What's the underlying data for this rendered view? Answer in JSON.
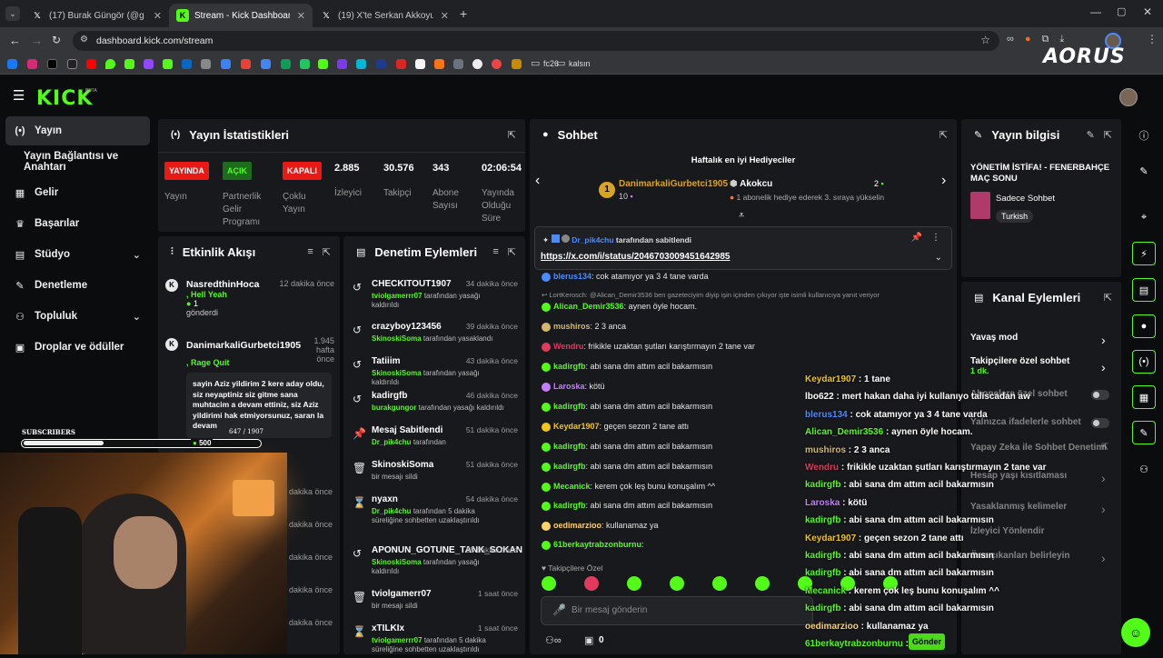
{
  "browser": {
    "tabs": [
      {
        "title": "(17) Burak Güngör (@gungorbu",
        "icon": "X"
      },
      {
        "title": "Stream - Kick Dashboard",
        "icon": "K"
      },
      {
        "title": "(19) X'te Serkan Akkoyun: \"Fen",
        "icon": "X"
      }
    ],
    "url": "dashboard.kick.com/stream",
    "bookmarks": [
      "fc26",
      "kalsın"
    ],
    "brand_overlay": "AORUS"
  },
  "app": {
    "logo": "KICK",
    "logo_sup": "BETA",
    "nav": [
      {
        "label": "Yayın",
        "icon": "(•)"
      },
      {
        "label": "Yayın Bağlantısı ve Anahtarı",
        "icon": ""
      },
      {
        "label": "Gelir",
        "icon": "▦"
      },
      {
        "label": "Başarılar",
        "icon": "🏆"
      },
      {
        "label": "Stüdyo",
        "icon": "▤"
      },
      {
        "label": "Denetleme",
        "icon": "🔧"
      },
      {
        "label": "Topluluk",
        "icon": "👥"
      },
      {
        "label": "Droplar ve ödüller",
        "icon": "🎁"
      }
    ]
  },
  "stats": {
    "title": "Yayın İstatistikleri",
    "items": [
      {
        "badge": "YAYINDA",
        "label": "Yayın",
        "color": "#e91916"
      },
      {
        "badge": "AÇIK",
        "label": "Partnerlik Gelir Programı",
        "color": "#2aa829"
      },
      {
        "badge": "KAPALI",
        "label": "Çoklu Yayın",
        "color": "#e91916"
      },
      {
        "value": "2.885",
        "label": "İzleyici"
      },
      {
        "value": "30.576",
        "label": "Takipçi"
      },
      {
        "value": "343",
        "label": "Abone Sayısı"
      },
      {
        "value": "02:06:54",
        "label": "Yayında Olduğu Süre"
      }
    ]
  },
  "activity": {
    "title": "Etkinlik Akışı",
    "items": [
      {
        "user": "NasredthinHoca",
        "time": "12 dakika önce",
        "msg": "Hell Yeah",
        "count": "1",
        "sub": "gönderdi"
      },
      {
        "user": "DanimarkaliGurbetci1905",
        "time": "1.945 hafta önce",
        "msg": "Rage Quit",
        "text": "sayin Aziz yildirim 2 kere aday oldu, siz neyaptiniz siz gitme sana muhtacim a devam ettiniz, siz Aziz yildirimi hak etmiyorsunuz, saran la devam"
      }
    ],
    "more_times": [
      "dakika önce",
      "dakika önce",
      "dakika önce",
      "dakika önce",
      "dakika önce",
      "dakika önce"
    ]
  },
  "mod": {
    "title": "Denetim Eylemleri",
    "items": [
      {
        "icon": "↺",
        "name": "CHECKITOUT1907",
        "time": "34 dakika önce",
        "actor": "tviolgamerrr07",
        "desc": "tarafından yasağı kaldırıldı"
      },
      {
        "icon": "↺",
        "name": "crazyboy123456",
        "time": "39 dakika önce",
        "actor": "SkinoskiSoma",
        "desc": "tarafından yasaklandı"
      },
      {
        "icon": "↺",
        "name": "Tatiiim",
        "time": "43 dakika önce",
        "actor": "SkinoskiSoma",
        "desc": "tarafından yasağı kaldırıldı"
      },
      {
        "icon": "↺",
        "name": "kadirgfb",
        "time": "46 dakika önce",
        "actor": "burakgungor",
        "desc": "tarafından yasağı kaldırıldı"
      },
      {
        "icon": "📌",
        "name": "Mesaj Sabitlendi",
        "time": "51 dakika önce",
        "actor": "Dr_pik4chu",
        "desc": "tarafından"
      },
      {
        "icon": "🗑",
        "name": "SkinoskiSoma",
        "time": "51 dakika önce",
        "actor": "",
        "desc": "bir mesajı sildi"
      },
      {
        "icon": "⌛",
        "name": "nyaxn",
        "time": "54 dakika önce",
        "actor": "Dr_pik4chu",
        "desc": "tarafından 5 dakika süreliğine sohbetten uzaklaştırıldı"
      },
      {
        "icon": "↺",
        "name": "APONUN_GOTUNE_TANK_SOKAN",
        "time": "55 dakika önce",
        "actor": "SkinoskiSoma",
        "desc": "tarafından yasağı kaldırıldı"
      },
      {
        "icon": "🗑",
        "name": "tviolgamerr07",
        "time": "1 saat önce",
        "actor": "",
        "desc": "bir mesajı sildi"
      },
      {
        "icon": "⌛",
        "name": "xTILKIx",
        "time": "1 saat önce",
        "actor": "tviolgamerrr07",
        "desc": "tarafından 5 dakika süreliğine sohbetten uzaklaştırıldı"
      }
    ]
  },
  "chat": {
    "title": "Sohbet",
    "top_gifters_title": "Haftalık en iyi Hediyeciler",
    "gifter1": {
      "name": "DanimarkaliGurbetci1905",
      "count": "10",
      "rank": "1"
    },
    "gifter2": {
      "name": "Akokcu",
      "count": "2",
      "note": "1 abonelik hediye ederek 3. sıraya yükselin"
    },
    "pinned_by": "Dr_pik4chu",
    "pinned_suffix": "tarafından sabitlendi",
    "pinned_link": "https://x.com/i/status/2046703009451642985",
    "messages": [
      {
        "user": "blerus134",
        "text": "cok atamıyor ya 3 4 tane varda",
        "color": "#4a8cff"
      },
      {
        "user": "",
        "text": "LortKerosch: @Alican_Demir3536 ben gazeteciyim diyip işin içinden çıkıyor işte isimli kullanıcıya yanıt veriyor",
        "color": "#999",
        "reply": true
      },
      {
        "user": "Alican_Demir3536",
        "text": "aynen öyle hocam.",
        "color": "#53fc18"
      },
      {
        "user": "mushiros",
        "text": "2 3 anca",
        "color": "#d4b86a"
      },
      {
        "user": "Wendru",
        "text": "frikikle uzaktan şutları karıştırmayın 2 tane var",
        "color": "#e23a5c"
      },
      {
        "user": "kadirgfb",
        "text": "abi sana dm attım acil bakarmısın",
        "color": "#53fc18"
      },
      {
        "user": "Laroska",
        "text": "kötü",
        "color": "#c77dff"
      },
      {
        "user": "kadirgfb",
        "text": "abi sana dm attım acil bakarmısın",
        "color": "#53fc18"
      },
      {
        "user": "Keydar1907",
        "text": "geçen sezon 2 tane attı",
        "color": "#f0c419"
      },
      {
        "user": "kadirgfb",
        "text": "abi sana dm attım acil bakarmısın",
        "color": "#53fc18"
      },
      {
        "user": "kadirgfb",
        "text": "abi sana dm attım acil bakarmısın",
        "color": "#53fc18"
      },
      {
        "user": "Mecanick",
        "text": "kerem çok leş bunu konuşalım ^^",
        "color": "#53fc18"
      },
      {
        "user": "kadirgfb",
        "text": "abi sana dm attım acil bakarmısın",
        "color": "#53fc18"
      },
      {
        "user": "oedimarzioo",
        "text": "kullanamaz ya",
        "color": "#ffd166"
      },
      {
        "user": "61berkaytrabzonburnu",
        "text": "",
        "color": "#53fc18"
      }
    ],
    "followers_only": "Takipçilere Özel",
    "input_placeholder": "Bir mesaj gönderin",
    "viewer_count": "0"
  },
  "overlay": {
    "lines": [
      {
        "user": "Keydar1907",
        "text": "1 tane",
        "color": "#f0c419"
      },
      {
        "user": "lbo622",
        "text": "mert hakan daha iyi kullanıyo taliscadan aw",
        "color": "#ffffff"
      },
      {
        "user": "blerus134",
        "text": "cok atamıyor ya 3 4 tane varda",
        "color": "#4a8cff"
      },
      {
        "user": "Alican_Demir3536",
        "text": "aynen öyle hocam.",
        "color": "#53fc18"
      },
      {
        "user": "mushiros",
        "text": "2 3 anca",
        "color": "#d4b86a"
      },
      {
        "user": "Wendru",
        "text": "frikikle uzaktan şutları karıştırmayın 2 tane var",
        "color": "#e23a5c"
      },
      {
        "user": "kadirgfb",
        "text": "abi sana dm attım acil bakarmısın",
        "color": "#53fc18"
      },
      {
        "user": "Laroska",
        "text": "kötü",
        "color": "#c77dff"
      },
      {
        "user": "kadirgfb",
        "text": "abi sana dm attım acil bakarmısın",
        "color": "#53fc18"
      },
      {
        "user": "Keydar1907",
        "text": "geçen sezon 2 tane attı",
        "color": "#f0c419"
      },
      {
        "user": "kadirgfb",
        "text": "abi sana dm attım acil bakarmısın",
        "color": "#53fc18"
      },
      {
        "user": "kadirgfb",
        "text": "abi sana dm attım acil bakarmısın",
        "color": "#53fc18"
      },
      {
        "user": "Mecanick",
        "text": "kerem çok leş bunu konuşalım ^^",
        "color": "#53fc18"
      },
      {
        "user": "kadirgfb",
        "text": "abi sana dm attım acil bakarmısın",
        "color": "#53fc18"
      },
      {
        "user": "oedimarzioo",
        "text": "kullanamaz ya",
        "color": "#ffd166"
      },
      {
        "user": "61berkaytrabzonburnu",
        "text": "",
        "color": "#53fc18"
      }
    ],
    "subscribers_label": "SUBSCRIBERS",
    "subs_count": "647 / 1907",
    "subs_progress": 0.34,
    "goal_value": "500",
    "send_label": "Gönder"
  },
  "info": {
    "title": "Yayın bilgisi",
    "stream_title": "YÖNETİM İSTİFA! - FENERBAHÇE MAÇ SONU",
    "category": "Sadece Sohbet",
    "language": "Turkish"
  },
  "actions": {
    "title": "Kanal Eylemleri",
    "items": [
      {
        "label": "Yavaş mod",
        "kind": "chev"
      },
      {
        "label": "Takipçilere özel sohbet",
        "sub": "1 dk.",
        "kind": "chev"
      },
      {
        "label": "Abonelere özel sohbet",
        "kind": "toggle"
      },
      {
        "label": "Yalnızca ifadelerle sohbet",
        "kind": "toggle"
      },
      {
        "label": "Yapay Zeka ile Sohbet Denetimi",
        "kind": "link"
      },
      {
        "label": "Hesap yaşı kısıtlaması",
        "kind": "chev"
      },
      {
        "label": "Yasaklanmış kelimeler",
        "kind": "chev"
      },
      {
        "label": "İzleyici Yönlendir",
        "kind": "none"
      },
      {
        "label": "Öne çıkanları belirleyin",
        "kind": "chev"
      }
    ]
  },
  "colors": {
    "kick_green": "#53fc18",
    "bg": "#0b0c0e",
    "panel": "#18191c",
    "live_red": "#e91916"
  }
}
